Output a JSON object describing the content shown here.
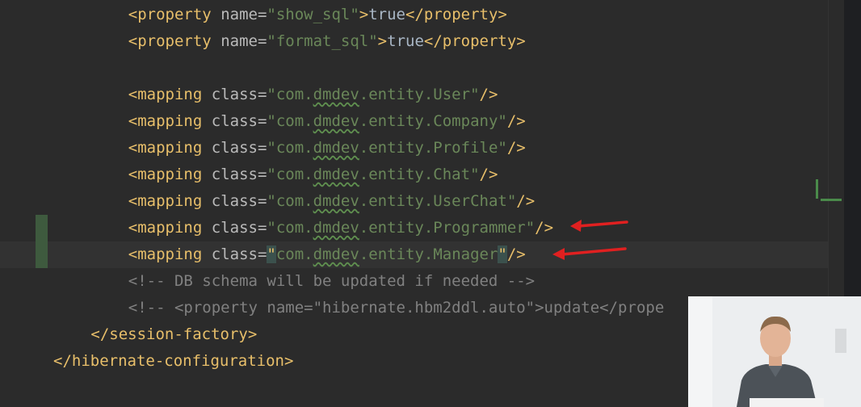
{
  "editor": {
    "lines": [
      {
        "indent": "        ",
        "parts": [
          [
            "tag",
            "<property "
          ],
          [
            "attr",
            "name="
          ],
          [
            "val",
            "\"show_sql\""
          ],
          [
            "tag",
            ">"
          ],
          [
            "txt",
            "true"
          ],
          [
            "tag",
            "</property>"
          ]
        ]
      },
      {
        "indent": "        ",
        "parts": [
          [
            "tag",
            "<property "
          ],
          [
            "attr",
            "name="
          ],
          [
            "val",
            "\"format_sql\""
          ],
          [
            "tag",
            ">"
          ],
          [
            "txt",
            "true"
          ],
          [
            "tag",
            "</property>"
          ]
        ]
      },
      {
        "indent": "",
        "parts": []
      },
      {
        "indent": "        ",
        "parts": [
          [
            "tag",
            "<mapping "
          ],
          [
            "attr",
            "class="
          ],
          [
            "val",
            "\"com."
          ],
          [
            "wavy",
            "dmdev"
          ],
          [
            "val",
            ".entity.User\""
          ],
          [
            "tag",
            "/>"
          ]
        ]
      },
      {
        "indent": "        ",
        "parts": [
          [
            "tag",
            "<mapping "
          ],
          [
            "attr",
            "class="
          ],
          [
            "val",
            "\"com."
          ],
          [
            "wavy",
            "dmdev"
          ],
          [
            "val",
            ".entity.Company\""
          ],
          [
            "tag",
            "/>"
          ]
        ]
      },
      {
        "indent": "        ",
        "parts": [
          [
            "tag",
            "<mapping "
          ],
          [
            "attr",
            "class="
          ],
          [
            "val",
            "\"com."
          ],
          [
            "wavy",
            "dmdev"
          ],
          [
            "val",
            ".entity.Profile\""
          ],
          [
            "tag",
            "/>"
          ]
        ]
      },
      {
        "indent": "        ",
        "parts": [
          [
            "tag",
            "<mapping "
          ],
          [
            "attr",
            "class="
          ],
          [
            "val",
            "\"com."
          ],
          [
            "wavy",
            "dmdev"
          ],
          [
            "val",
            ".entity.Chat\""
          ],
          [
            "tag",
            "/>"
          ]
        ]
      },
      {
        "indent": "        ",
        "parts": [
          [
            "tag",
            "<mapping "
          ],
          [
            "attr",
            "class="
          ],
          [
            "val",
            "\"com."
          ],
          [
            "wavy",
            "dmdev"
          ],
          [
            "val",
            ".entity.UserChat\""
          ],
          [
            "tag",
            "/>"
          ]
        ]
      },
      {
        "indent": "        ",
        "parts": [
          [
            "tag",
            "<mapping "
          ],
          [
            "attr",
            "class="
          ],
          [
            "val",
            "\"com."
          ],
          [
            "wavy",
            "dmdev"
          ],
          [
            "val",
            ".entity.Programmer\""
          ],
          [
            "tag",
            "/>"
          ]
        ]
      },
      {
        "indent": "        ",
        "parts": [
          [
            "tag",
            "<mapping "
          ],
          [
            "attr",
            "class="
          ],
          [
            "quote",
            "\""
          ],
          [
            "val",
            "com."
          ],
          [
            "wavy",
            "dmdev"
          ],
          [
            "val",
            ".entity.Manager"
          ],
          [
            "quote",
            "\""
          ],
          [
            "tag",
            "/>"
          ]
        ]
      },
      {
        "indent": "        ",
        "parts": [
          [
            "cmt",
            "<!-- DB schema will be updated if needed -->"
          ]
        ]
      },
      {
        "indent": "        ",
        "parts": [
          [
            "cmt",
            "<!-- <property name=\"hibernate.hbm2ddl.auto\">update</prope"
          ]
        ]
      },
      {
        "indent": "    ",
        "parts": [
          [
            "tag",
            "</session-factory>"
          ]
        ]
      },
      {
        "indent": "",
        "parts": [
          [
            "tag",
            "</hibernate-configuration>"
          ]
        ]
      }
    ],
    "current_line_index": 9,
    "changed_line_indexes": [
      8,
      9
    ],
    "arrow_line_indexes": [
      8,
      9
    ]
  },
  "colors": {
    "background": "#2b2b2b",
    "tag": "#e8bf6a",
    "attribute": "#bababa",
    "value": "#6a8759",
    "comment": "#808080",
    "arrow": "#e02020"
  },
  "webcam": {
    "icon": "presenter-video-feed"
  }
}
